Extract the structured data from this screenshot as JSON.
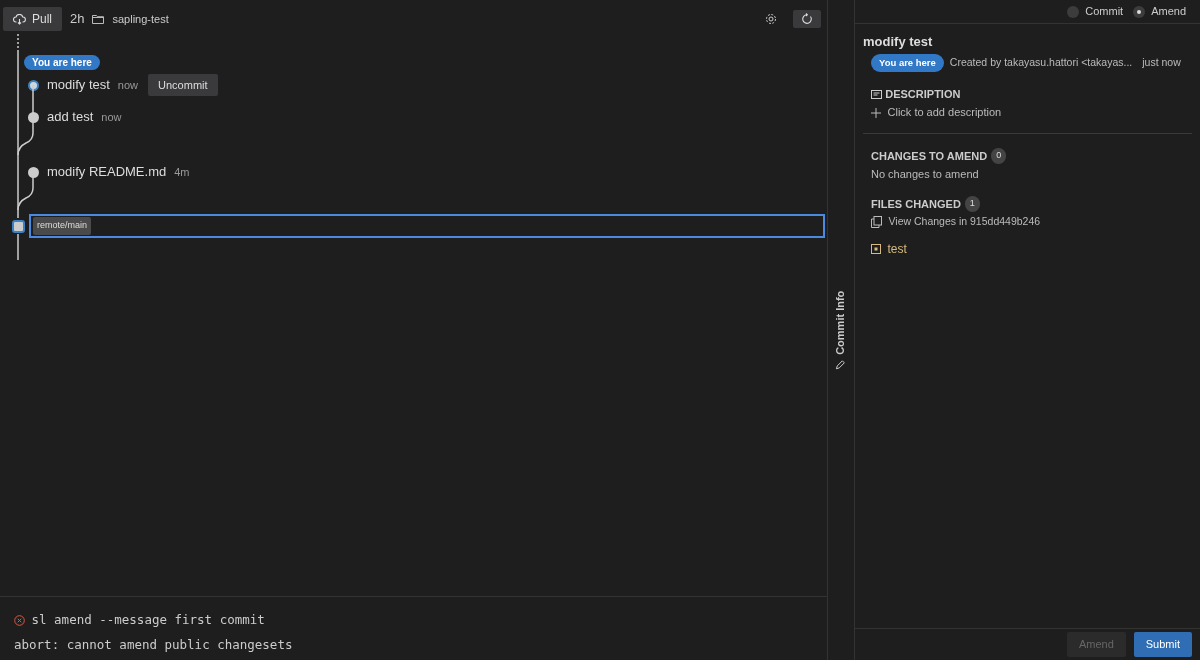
{
  "toolbar": {
    "pull_label": "Pull",
    "fetch_age": "2h",
    "repo": "sapling-test"
  },
  "commits": [
    {
      "kind": "draft",
      "title": "modify test",
      "time": "now",
      "current": true,
      "badge": "You are here",
      "action": "Uncommit"
    },
    {
      "kind": "draft",
      "title": "add test",
      "time": "now",
      "current": false
    },
    {
      "kind": "draft",
      "title": "modify README.md",
      "time": "4m",
      "current": false
    },
    {
      "kind": "public",
      "bookmark": "remote/main",
      "selected": true
    }
  ],
  "terminal": {
    "command": "sl amend --message first commit",
    "output": "abort: cannot amend public changesets",
    "failed": true
  },
  "side_tab": {
    "label": "Commit Info"
  },
  "commit_info": {
    "modes": [
      {
        "label": "Commit",
        "selected": false
      },
      {
        "label": "Amend",
        "selected": true
      }
    ],
    "title": "modify test",
    "badge": "You are here",
    "created_by": "Created by takayasu.hattori <takayas...",
    "time": "just now",
    "description_heading": "DESCRIPTION",
    "description_placeholder": "Click to add description",
    "changes_heading": "CHANGES TO AMEND",
    "changes_count": "0",
    "changes_empty": "No changes to amend",
    "files_heading": "FILES CHANGED",
    "files_count": "1",
    "view_changes": "View Changes in 915dd449b246",
    "files": [
      {
        "name": "test",
        "kind": "modified"
      }
    ],
    "buttons": [
      {
        "label": "Amend",
        "disabled": true
      },
      {
        "label": "Submit",
        "disabled": false
      }
    ]
  }
}
